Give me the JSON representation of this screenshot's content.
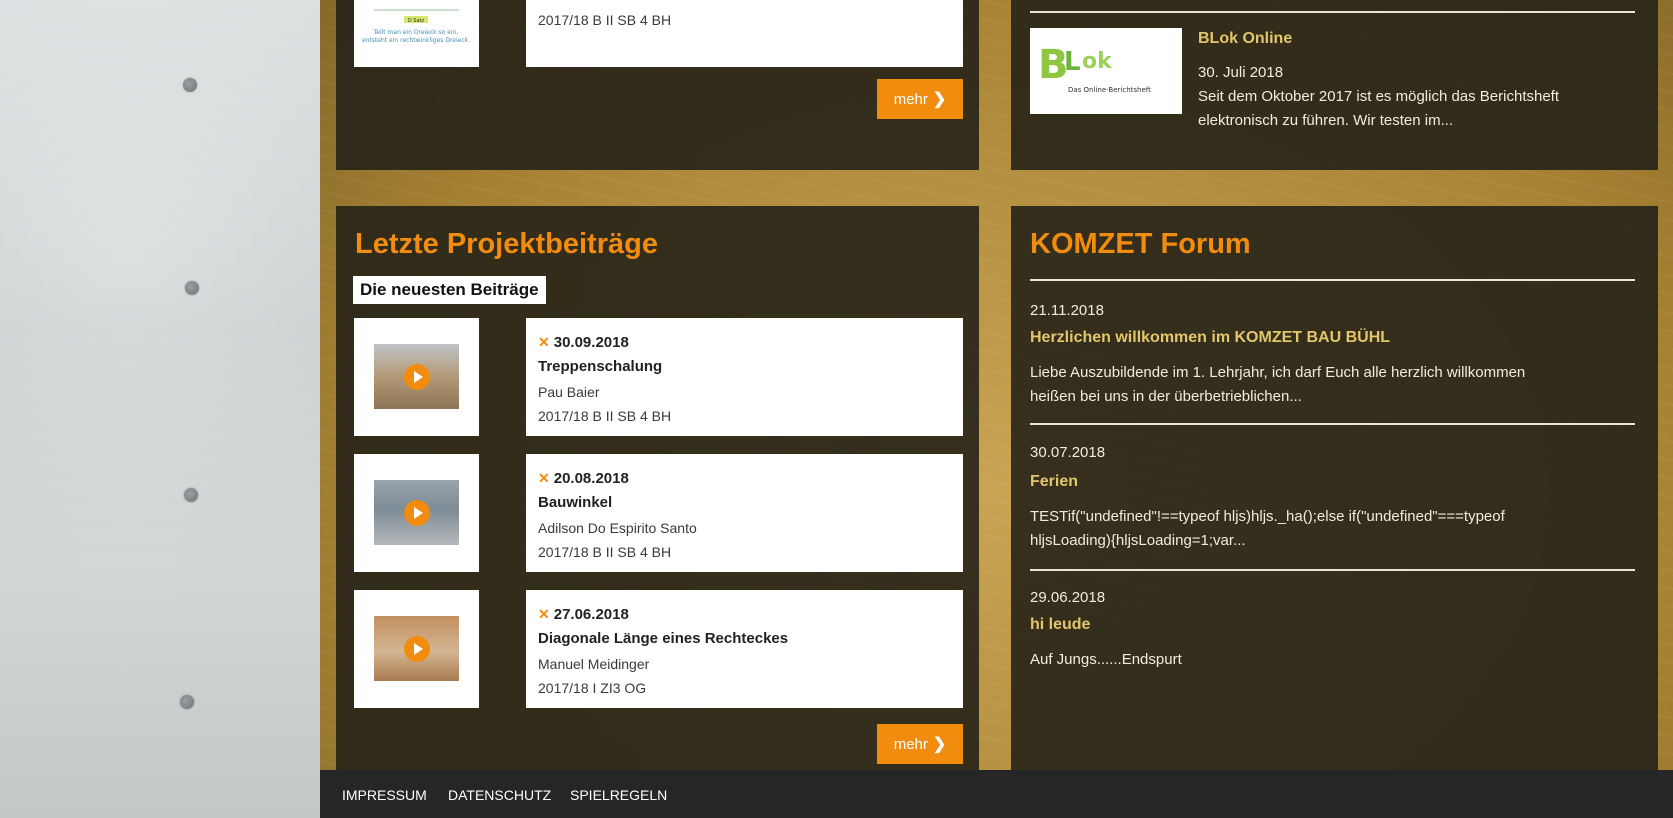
{
  "top_left_card": {
    "group": "2017/18 B II SB 4 BH",
    "thumb_caption": "Teilt man ein Dreieck so ein, entsteht ein rechtwinkliges Dreieck."
  },
  "mehr_label": "mehr",
  "blok": {
    "title": "BLok Online",
    "date": "30. Juli 2018",
    "text_line1": "Seit dem Oktober 2017 ist es möglich das Berichtsheft",
    "text_line2": "elektronisch zu führen. Wir testen im...",
    "logo_text": "Das Online-Berichtsheft"
  },
  "projects": {
    "heading": "Letzte Projektbeiträge",
    "subheading": "Die neuesten Beiträge",
    "items": [
      {
        "date": "30.09.2018",
        "title": "Treppenschalung",
        "author": "Pau Baier",
        "group": "2017/18 B II SB 4 BH"
      },
      {
        "date": "20.08.2018",
        "title": "Bauwinkel",
        "author": "Adilson Do Espirito Santo",
        "group": "2017/18 B II SB 4 BH"
      },
      {
        "date": "27.06.2018",
        "title": "Diagonale Länge eines Rechteckes",
        "author": "Manuel Meidinger",
        "group": "2017/18 I ZI3 OG"
      }
    ]
  },
  "forum": {
    "heading": "KOMZET Forum",
    "posts": [
      {
        "date": "21.11.2018",
        "title": "Herzlichen willkommen im KOMZET BAU BÜHL",
        "line1": "Liebe Auszubildende im 1. Lehrjahr, ich darf Euch alle herzlich willkommen",
        "line2": "heißen bei uns in der überbetrieblichen..."
      },
      {
        "date": "30.07.2018",
        "title": "Ferien",
        "line1": "TESTif(\"undefined\"!==typeof hljs)hljs._ha();else if(\"undefined\"===typeof",
        "line2": "hljsLoading){hljsLoading=1;var..."
      },
      {
        "date": "29.06.2018",
        "title": "hi leude",
        "line1": "Auf Jungs......Endspurt",
        "line2": ""
      }
    ]
  },
  "footer": {
    "impressum": "IMPRESSUM",
    "datenschutz": "DATENSCHUTZ",
    "spielregeln": "SPIELREGELN"
  },
  "colors": {
    "accent": "#f28c0f",
    "forum_title": "#e2c66c",
    "panel": "#262218",
    "footer": "#262626"
  }
}
